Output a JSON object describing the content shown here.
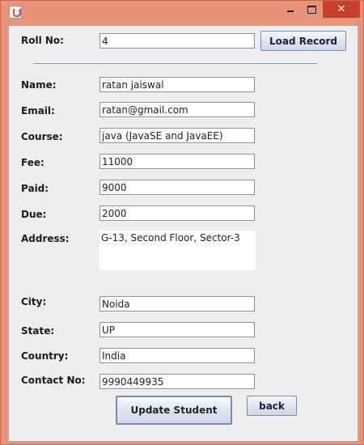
{
  "window": {
    "title": "",
    "controls": {
      "close_symbol": "✕"
    }
  },
  "form": {
    "roll_no": {
      "label": "Roll No:",
      "value": "4"
    },
    "load_button": "Load Record",
    "fields": {
      "name": {
        "label": "Name:",
        "value": "ratan jaiswal"
      },
      "email": {
        "label": "Email:",
        "value": "ratan@gmail.com"
      },
      "course": {
        "label": "Course:",
        "value": "java (JavaSE and JavaEE)"
      },
      "fee": {
        "label": "Fee:",
        "value": "11000"
      },
      "paid": {
        "label": "Paid:",
        "value": "9000"
      },
      "due": {
        "label": "Due:",
        "value": "2000"
      },
      "address": {
        "label": "Address:",
        "value": "G-13, Second Floor, Sector-3"
      },
      "city": {
        "label": "City:",
        "value": "Noida"
      },
      "state": {
        "label": "State:",
        "value": "UP"
      },
      "country": {
        "label": "Country:",
        "value": "India"
      },
      "contact": {
        "label": "Contact No:",
        "value": "9990449935"
      }
    },
    "update_button": "Update Student",
    "back_button": "back"
  },
  "icons": {
    "app": "java-app-icon",
    "minimize": "minimize-icon",
    "maximize": "maximize-icon",
    "close": "close-icon"
  },
  "colors": {
    "window_frame": "#e8927a",
    "close_button": "#c7402d",
    "content_bg": "#eeeeee",
    "separator": "#7b9ab8"
  }
}
